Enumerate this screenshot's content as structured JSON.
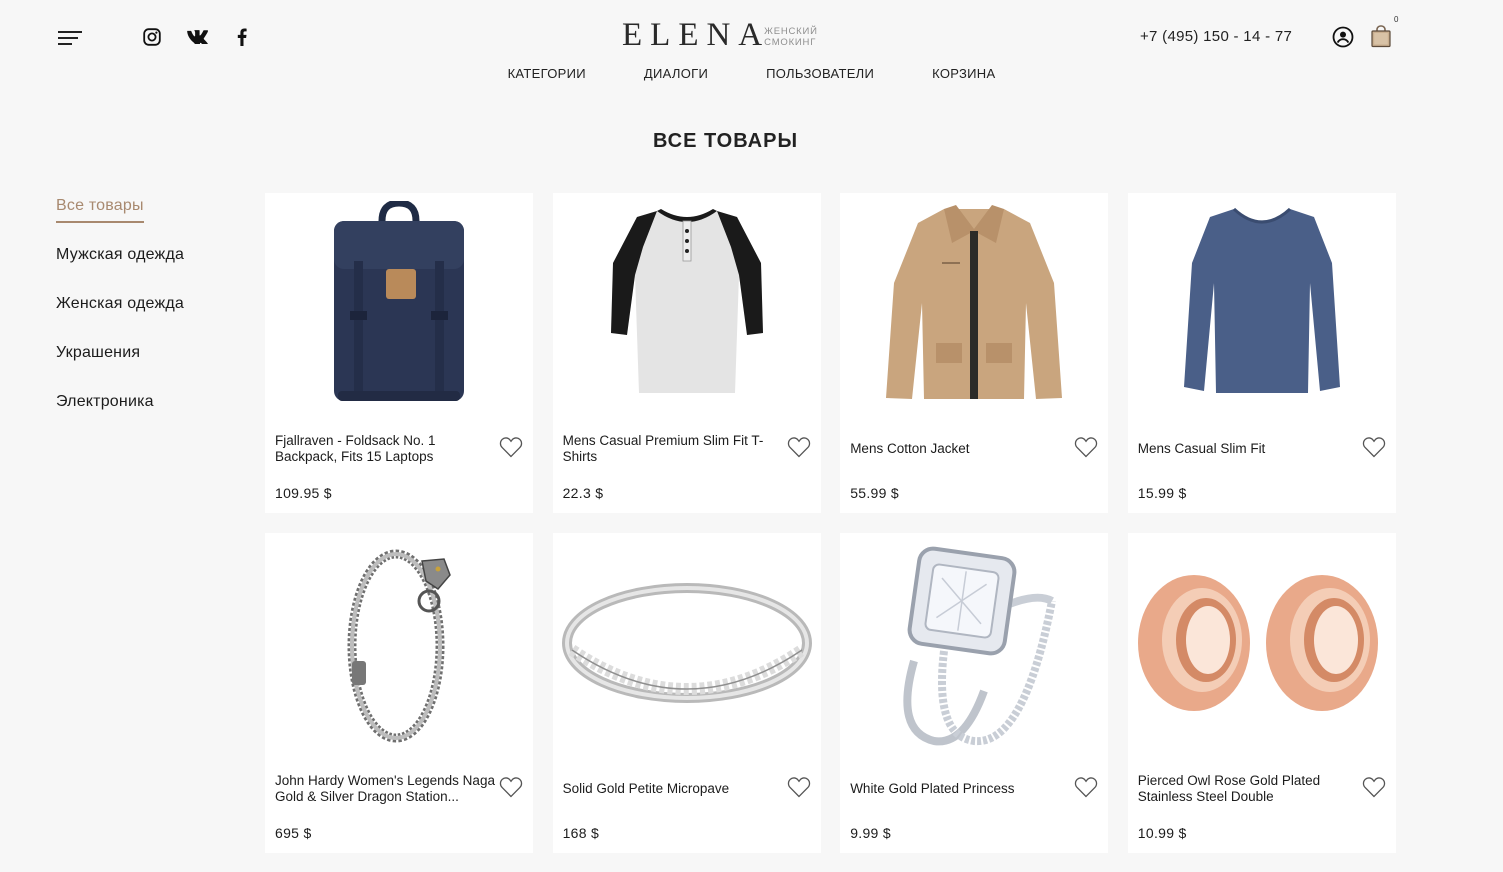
{
  "header": {
    "logo_main": "ELENA",
    "logo_sub_line1": "ЖЕНСКИЙ",
    "logo_sub_line2": "СМОКИНГ",
    "phone": "+7 (495) 150 - 14 - 77",
    "cart_count": "0",
    "icons": {
      "menu": "hamburger-menu-icon",
      "instagram": "instagram-icon",
      "vk": "vk-icon",
      "facebook": "facebook-icon",
      "user": "user-icon",
      "cart": "shopping-bag-icon"
    }
  },
  "nav": {
    "items": [
      "КАТЕГОРИИ",
      "ДИАЛОГИ",
      "ПОЛЬЗОВАТЕЛИ",
      "КОРЗИНА"
    ]
  },
  "page": {
    "title": "ВСЕ ТОВАРЫ"
  },
  "sidebar": {
    "items": [
      "Все товары",
      "Мужская одежда",
      "Женская одежда",
      "Украшения",
      "Электроника"
    ],
    "active_index": 0
  },
  "products": [
    {
      "title": "Fjallraven - Foldsack No. 1 Backpack, Fits 15 Laptops",
      "price": "109.95 $",
      "image": "navy-backpack"
    },
    {
      "title": "Mens Casual Premium Slim Fit T-Shirts",
      "price": "22.3 $",
      "image": "raglan-tshirt"
    },
    {
      "title": "Mens Cotton Jacket",
      "price": "55.99 $",
      "image": "beige-jacket"
    },
    {
      "title": "Mens Casual Slim Fit",
      "price": "15.99 $",
      "image": "blue-longsleeve"
    },
    {
      "title": "John Hardy Women's Legends Naga Gold & Silver Dragon Station...",
      "price": "695 $",
      "image": "dragon-bracelet"
    },
    {
      "title": "Solid Gold Petite Micropave",
      "price": "168 $",
      "image": "micropave-ring"
    },
    {
      "title": "White Gold Plated Princess",
      "price": "9.99 $",
      "image": "princess-ring-set"
    },
    {
      "title": "Pierced Owl Rose Gold Plated Stainless Steel Double",
      "price": "10.99 $",
      "image": "rose-gold-tunnels"
    }
  ],
  "colors": {
    "accent": "#a8896f",
    "background": "#f7f7f7",
    "card": "#ffffff",
    "text": "#1c1c1c"
  }
}
